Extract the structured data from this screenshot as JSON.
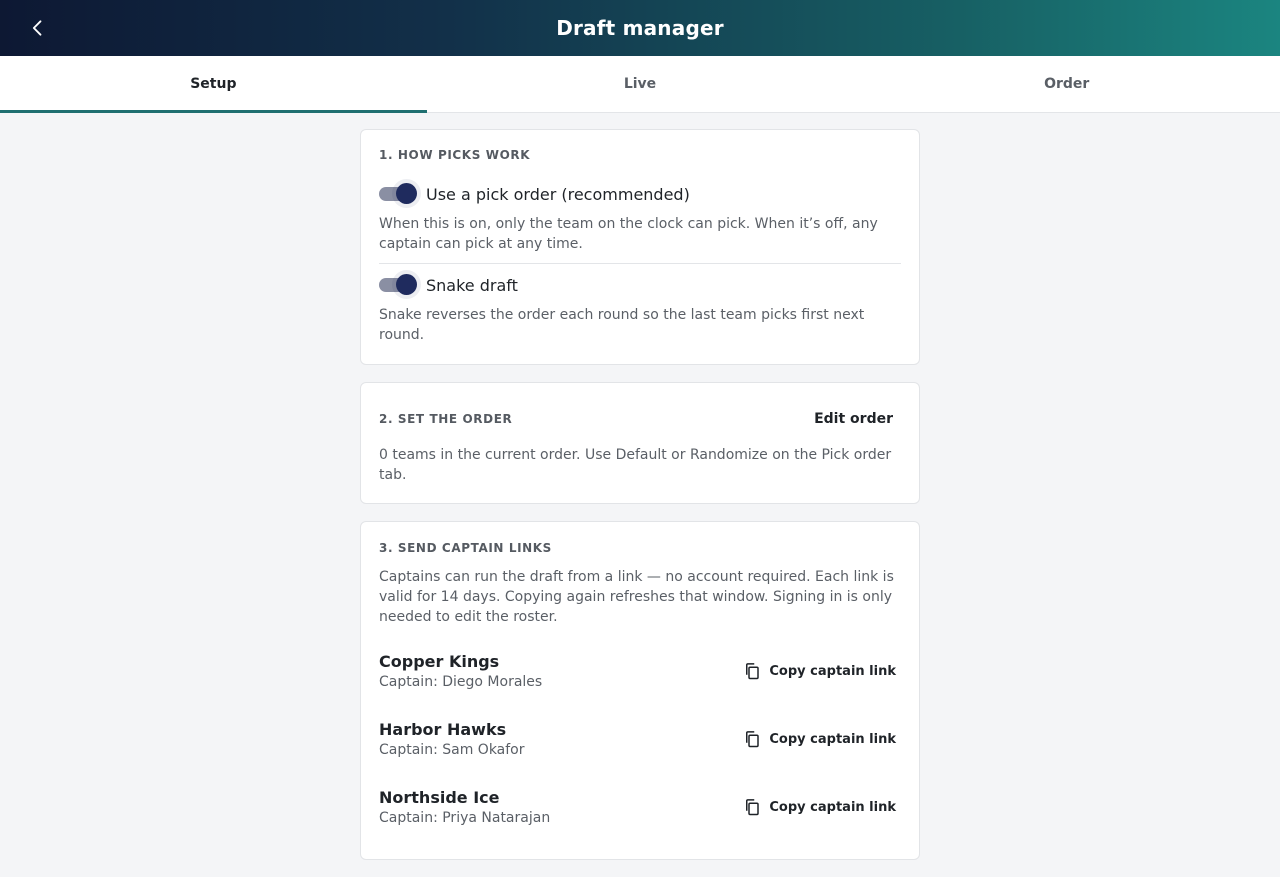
{
  "appbar": {
    "title": "Draft manager",
    "back_icon": "chevron-left-icon"
  },
  "tabs": [
    {
      "label": "Setup",
      "active": true
    },
    {
      "label": "Live",
      "active": false
    },
    {
      "label": "Order",
      "active": false
    }
  ],
  "section1": {
    "title": "1. HOW PICKS WORK",
    "toggle1": {
      "label": "Use a pick order (recommended)",
      "on": true,
      "helper": "When this is on, only the team on the clock can pick. When it’s off, any captain can pick at any time."
    },
    "toggle2": {
      "label": "Snake draft",
      "on": true,
      "helper": "Snake reverses the order each round so the last team picks first next round."
    }
  },
  "section2": {
    "title": "2. SET THE ORDER",
    "edit_label": "Edit order",
    "helper": "0 teams in the current order. Use Default or Randomize on the Pick order tab."
  },
  "section3": {
    "title": "3. SEND CAPTAIN LINKS",
    "helper": "Captains can run the draft from a link — no account required. Each link is valid for 14 days. Copying again refreshes that window. Signing in is only needed to edit the roster.",
    "teams": [
      {
        "name": "Copper Kings",
        "captain": "Captain: Diego Morales",
        "copy_label": "Copy captain link"
      },
      {
        "name": "Harbor Hawks",
        "captain": "Captain: Sam Okafor",
        "copy_label": "Copy captain link"
      },
      {
        "name": "Northside Ice",
        "captain": "Captain: Priya Natarajan",
        "copy_label": "Copy captain link"
      }
    ]
  },
  "colors": {
    "accent": "#1f6f70",
    "toggle_thumb": "#1f2b5e",
    "toggle_track": "#8a8fa3"
  }
}
